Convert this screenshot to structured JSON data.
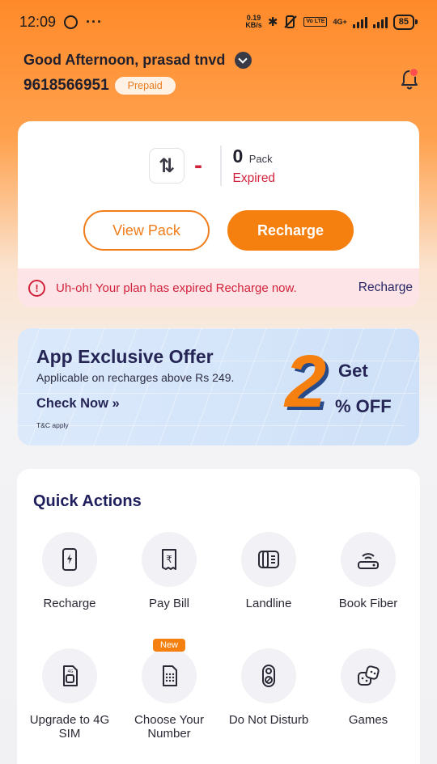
{
  "status_bar": {
    "time": "12:09",
    "more": "···",
    "net_speed_value": "0.19",
    "net_speed_unit": "KB/s",
    "volte": "Vo LTE",
    "net_type": "4G+",
    "battery": "85",
    "icons": [
      "whatsapp-icon",
      "bluetooth-icon",
      "mute-icon",
      "signal-icon",
      "battery-icon"
    ]
  },
  "header": {
    "greeting": "Good Afternoon, prasad tnvd",
    "phone_number": "9618566951",
    "plan_type": "Prepaid"
  },
  "pack_card": {
    "data_icon": "⇅",
    "dash": "-",
    "pack_count": "0",
    "pack_label": "Pack",
    "pack_status": "Expired",
    "view_pack_label": "View Pack",
    "recharge_label": "Recharge",
    "alert_symbol": "!",
    "banner_text": "Uh-oh! Your plan has expired  Recharge now.",
    "banner_link": "Recharge"
  },
  "offer": {
    "title": "App Exclusive Offer",
    "subtitle": "Applicable on recharges above Rs 249.",
    "cta": "Check Now »",
    "tc": "T&C apply",
    "big_number": "2",
    "get": "Get",
    "off": "% OFF"
  },
  "quick_actions": {
    "title": "Quick Actions",
    "new_badge": "New",
    "items": [
      {
        "label": "Recharge",
        "icon": "phone-bolt-icon"
      },
      {
        "label": "Pay Bill",
        "icon": "rupee-bill-icon"
      },
      {
        "label": "Landline",
        "icon": "landline-icon"
      },
      {
        "label": "Book Fiber",
        "icon": "router-icon"
      },
      {
        "label": "Upgrade to 4G SIM",
        "icon": "sim-4g-icon"
      },
      {
        "label": "Choose Your Number",
        "icon": "sim-number-icon"
      },
      {
        "label": "Do Not Disturb",
        "icon": "dnd-icon"
      },
      {
        "label": "Games",
        "icon": "games-icon"
      }
    ]
  },
  "colors": {
    "accent": "#f5800f",
    "error": "#d2233c",
    "navy": "#262656"
  }
}
